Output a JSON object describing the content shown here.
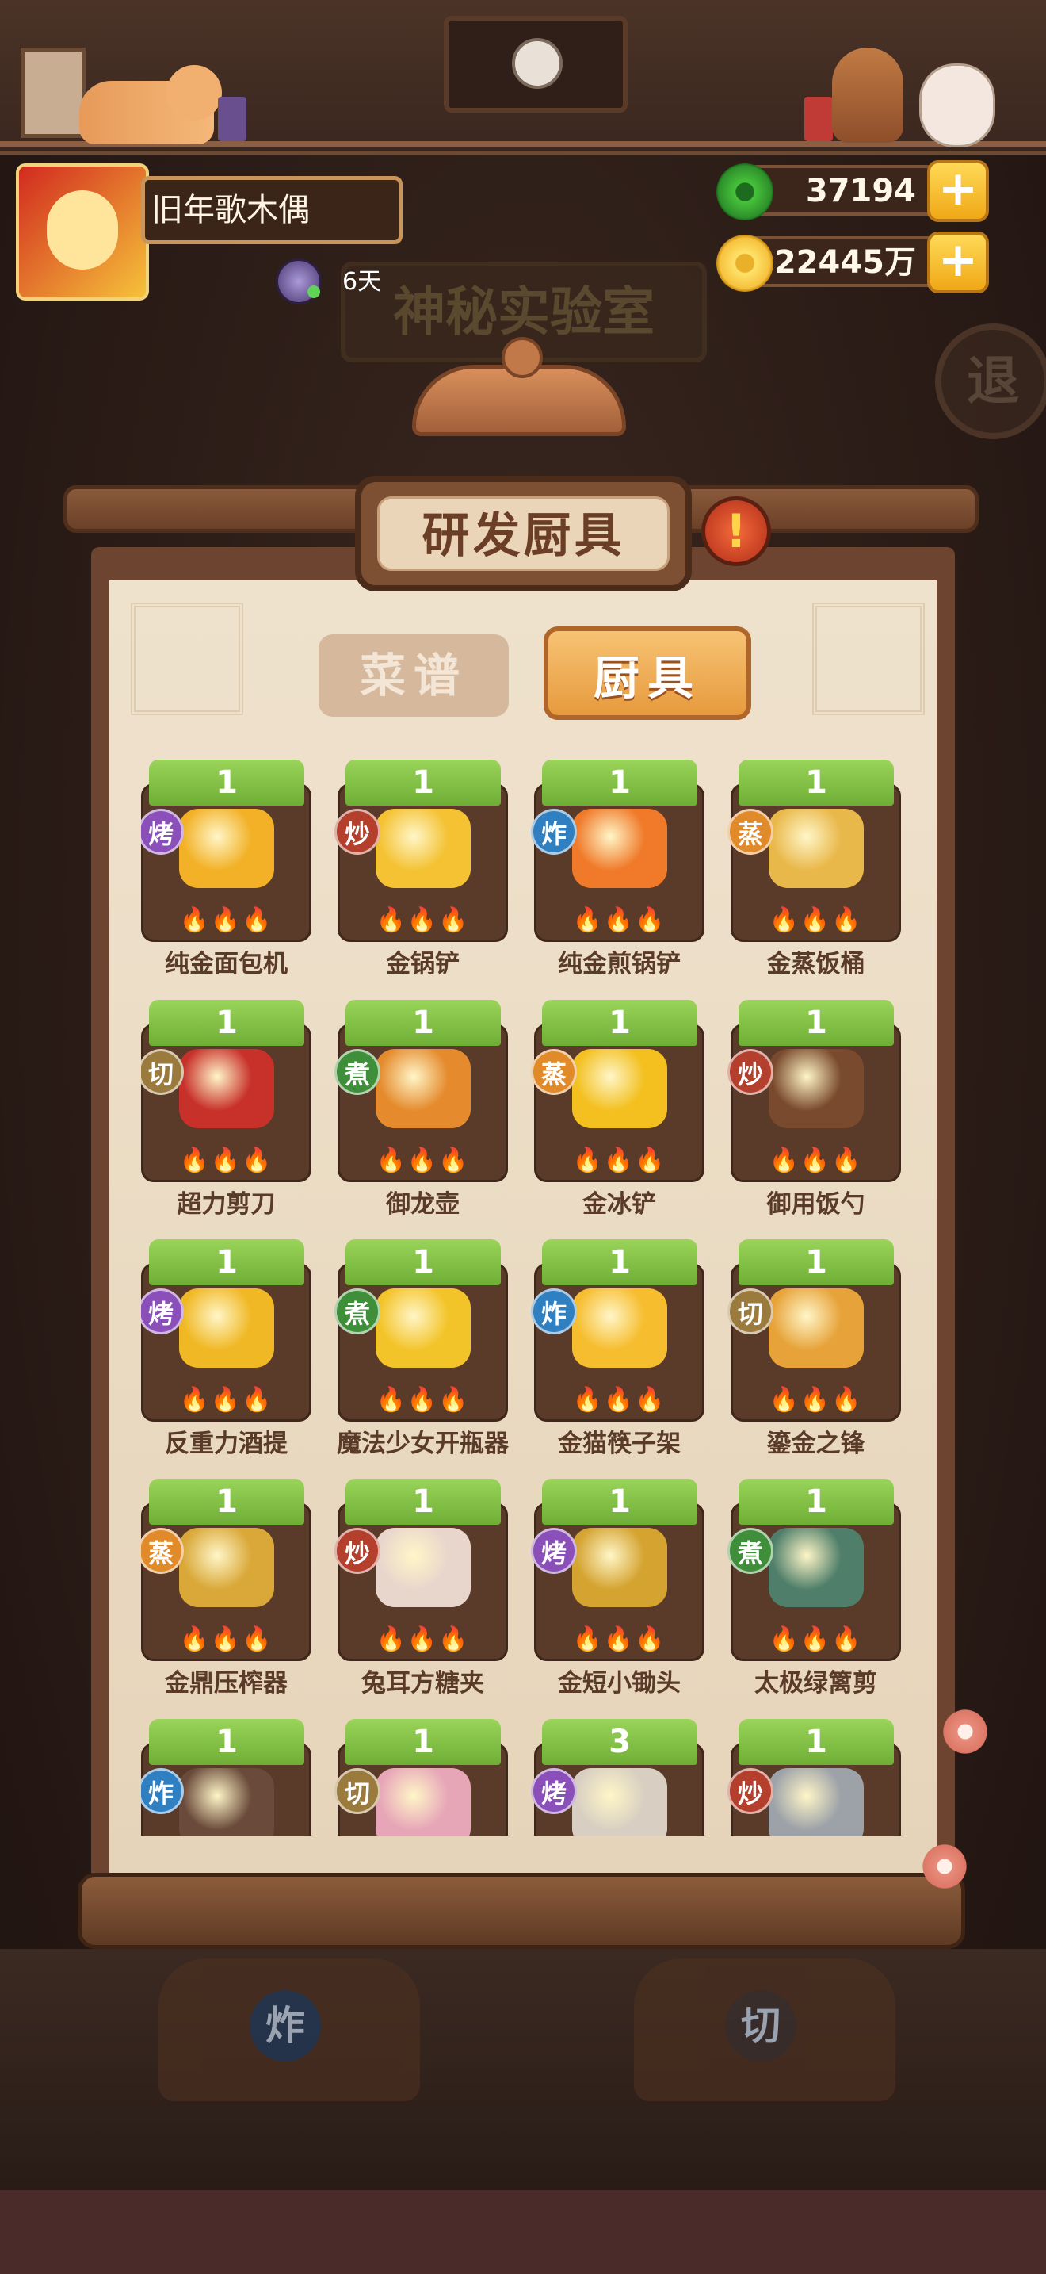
{
  "player": {
    "name": "旧年歌木偶",
    "status_days": "6天"
  },
  "currency": {
    "jade": "37194",
    "coins": "22445万"
  },
  "room": {
    "title": "神秘实验室",
    "exit_label": "退"
  },
  "panel": {
    "title": "研发厨具",
    "alert": "!"
  },
  "tabs": {
    "recipes": "菜谱",
    "tools": "厨具",
    "active": "tools"
  },
  "tools": [
    {
      "level": "1",
      "tag": "烤",
      "tag_type": "bake",
      "name": "纯金面包机",
      "color": "#f2b126"
    },
    {
      "level": "1",
      "tag": "炒",
      "tag_type": "stir",
      "name": "金锅铲",
      "color": "#f4c233"
    },
    {
      "level": "1",
      "tag": "炸",
      "tag_type": "fry",
      "name": "纯金煎锅铲",
      "color": "#f07a2a"
    },
    {
      "level": "1",
      "tag": "蒸",
      "tag_type": "steam",
      "name": "金蒸饭桶",
      "color": "#e9b84a"
    },
    {
      "level": "1",
      "tag": "切",
      "tag_type": "cut",
      "name": "超力剪刀",
      "color": "#c8302a"
    },
    {
      "level": "1",
      "tag": "煮",
      "tag_type": "boil",
      "name": "御龙壶",
      "color": "#e58b2e"
    },
    {
      "level": "1",
      "tag": "蒸",
      "tag_type": "steam",
      "name": "金冰铲",
      "color": "#f3c020"
    },
    {
      "level": "1",
      "tag": "炒",
      "tag_type": "stir",
      "name": "御用饭勺",
      "color": "#7a4a2e"
    },
    {
      "level": "1",
      "tag": "烤",
      "tag_type": "bake",
      "name": "反重力酒提",
      "color": "#f0b824"
    },
    {
      "level": "1",
      "tag": "煮",
      "tag_type": "boil",
      "name": "魔法少女开瓶器",
      "color": "#f3c42a"
    },
    {
      "level": "1",
      "tag": "炸",
      "tag_type": "fry",
      "name": "金猫筷子架",
      "color": "#f6bd2e"
    },
    {
      "level": "1",
      "tag": "切",
      "tag_type": "cut",
      "name": "鎏金之锋",
      "color": "#e7a33a"
    },
    {
      "level": "1",
      "tag": "蒸",
      "tag_type": "steam",
      "name": "金鼎压榨器",
      "color": "#d9a838"
    },
    {
      "level": "1",
      "tag": "炒",
      "tag_type": "stir",
      "name": "兔耳方糖夹",
      "color": "#e8d6cc"
    },
    {
      "level": "1",
      "tag": "烤",
      "tag_type": "bake",
      "name": "金短小锄头",
      "color": "#d4a330"
    },
    {
      "level": "1",
      "tag": "煮",
      "tag_type": "boil",
      "name": "太极绿篱剪",
      "color": "#4f7f6a"
    },
    {
      "level": "1",
      "tag": "炸",
      "tag_type": "fry",
      "name": "",
      "color": "#6a4a3a"
    },
    {
      "level": "1",
      "tag": "切",
      "tag_type": "cut",
      "name": "",
      "color": "#e7a6b8"
    },
    {
      "level": "3",
      "tag": "烤",
      "tag_type": "bake",
      "name": "",
      "color": "#d8cfc2"
    },
    {
      "level": "1",
      "tag": "炒",
      "tag_type": "stir",
      "name": "",
      "color": "#9da2a8"
    }
  ],
  "fire_icons": "🔥🔥🔥",
  "stoves": [
    {
      "label": "炸"
    },
    {
      "label": "切"
    }
  ]
}
